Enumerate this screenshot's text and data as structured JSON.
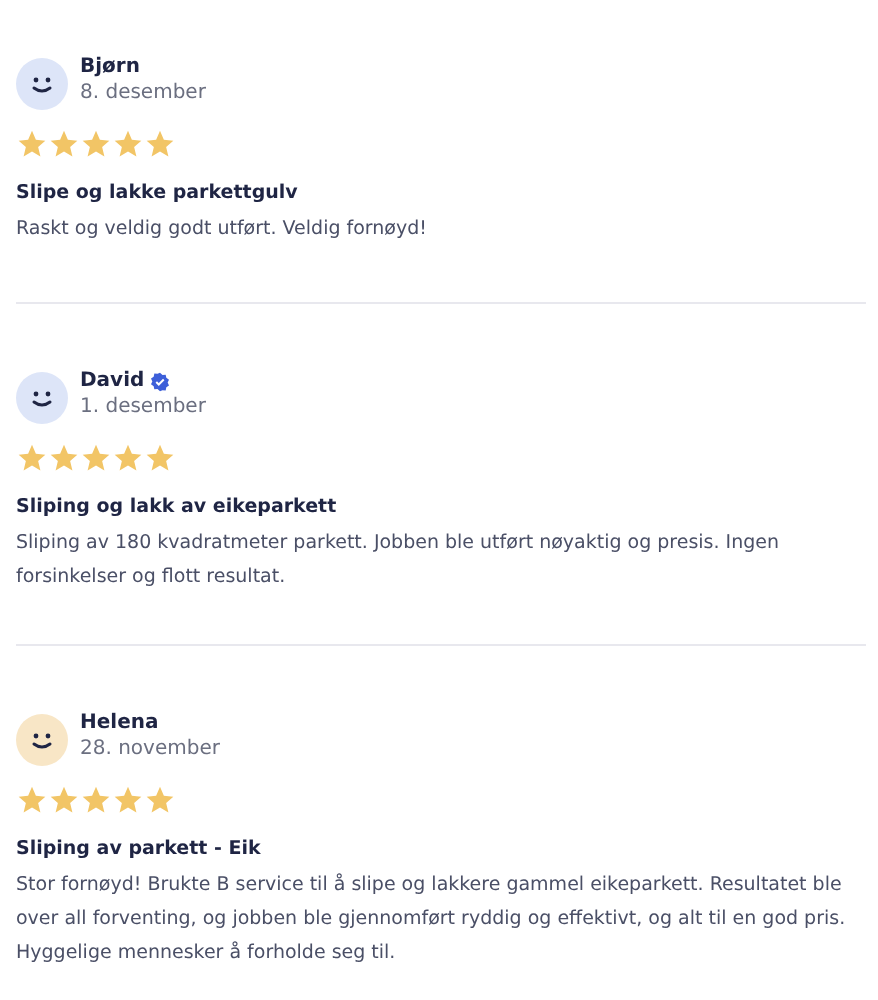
{
  "reviews": [
    {
      "name": "Bjørn",
      "verified": false,
      "color": "#dde5f8",
      "date": "8. desember",
      "stars": 5,
      "title": "Slipe og lakke parkettgulv",
      "body": "Raskt og veldig godt utført. Veldig fornøyd!"
    },
    {
      "name": "David",
      "verified": true,
      "color": "#dde5f8",
      "date": "1. desember",
      "stars": 5,
      "title": "Sliping og lakk av eikeparkett",
      "body": "Sliping av 180 kvadratmeter parkett. Jobben ble utført nøyaktig og presis. Ingen forsinkelser og flott resultat."
    },
    {
      "name": "Helena",
      "verified": false,
      "color": "#f8e6c6",
      "date": "28. november",
      "stars": 5,
      "title": "Sliping av parkett - Eik",
      "body": "Stor fornøyd! Brukte B service til å slipe og lakkere gammel eikeparkett. Resultatet ble over all forventing, og jobben ble gjennomført ryddig og effektivt, og alt til en god pris. Hyggelige mennesker å forholde seg til."
    }
  ]
}
